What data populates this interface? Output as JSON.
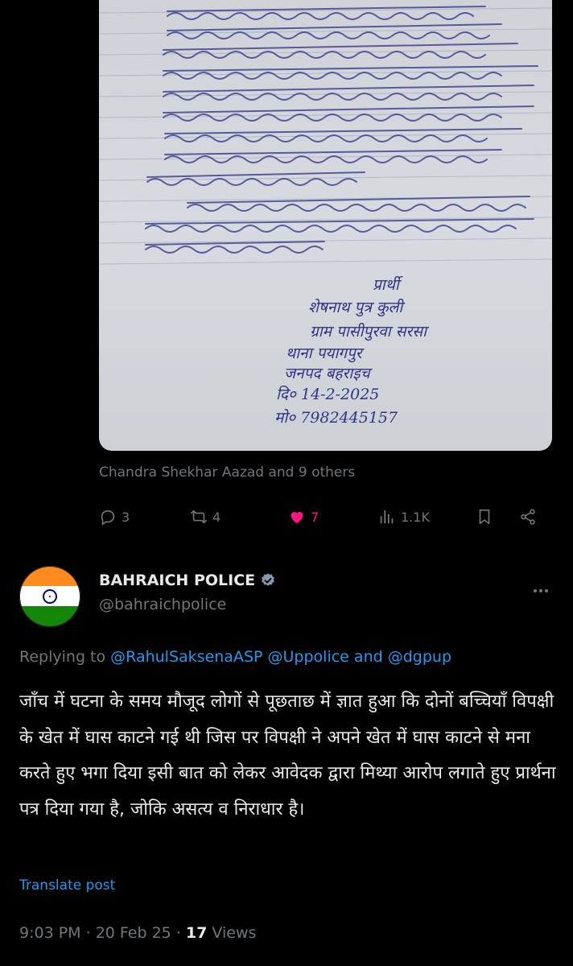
{
  "quoted": {
    "attribution": "Chandra Shekhar Aazad and 9 others",
    "letter_signature": [
      "प्रार्थी",
      "शेषनाथ पुत्र कुली",
      "ग्राम पासीपुरवा सरसा",
      "थाना पयागपुर",
      "जनपद बहराइच",
      "दि० 14-2-2025",
      "मो० 7982445157"
    ],
    "stats": {
      "replies": "3",
      "reposts": "4",
      "likes": "7",
      "views": "1.1K"
    }
  },
  "reply": {
    "author_name": "BAHRAICH POLICE",
    "handle": "@bahraichpolice",
    "replying_prefix": "Replying to",
    "replying_mentions": [
      "@RahulSaksenaASP",
      "@Uppolice"
    ],
    "replying_and": "and",
    "replying_last": "@dgpup",
    "text": "जाँच में घटना के समय मौजूद लोगों से पूछताछ में ज्ञात हुआ कि दोनों बच्चियाँ विपक्षी के खेत में घास काटने गई थी जिस पर विपक्षी ने अपने खेत में घास काटने से मना करते हुए भगा दिया इसी बात को लेकर आवेदक द्वारा मिथ्या आरोप लगाते हुए प्रार्थना पत्र दिया गया है, जोकि असत्य व निराधार है।",
    "translate_label": "Translate post",
    "time": "9:03 PM",
    "date": "20 Feb 25",
    "views_count": "17",
    "views_label": "Views"
  },
  "colors": {
    "background": "#000000",
    "text": "#e7e9ea",
    "muted": "#71767b",
    "link": "#1d9bf0",
    "like": "#f91880"
  },
  "icons": [
    "reply-icon",
    "repost-icon",
    "like-icon",
    "views-icon",
    "bookmark-icon",
    "share-icon",
    "verified-icon",
    "more-icon"
  ]
}
